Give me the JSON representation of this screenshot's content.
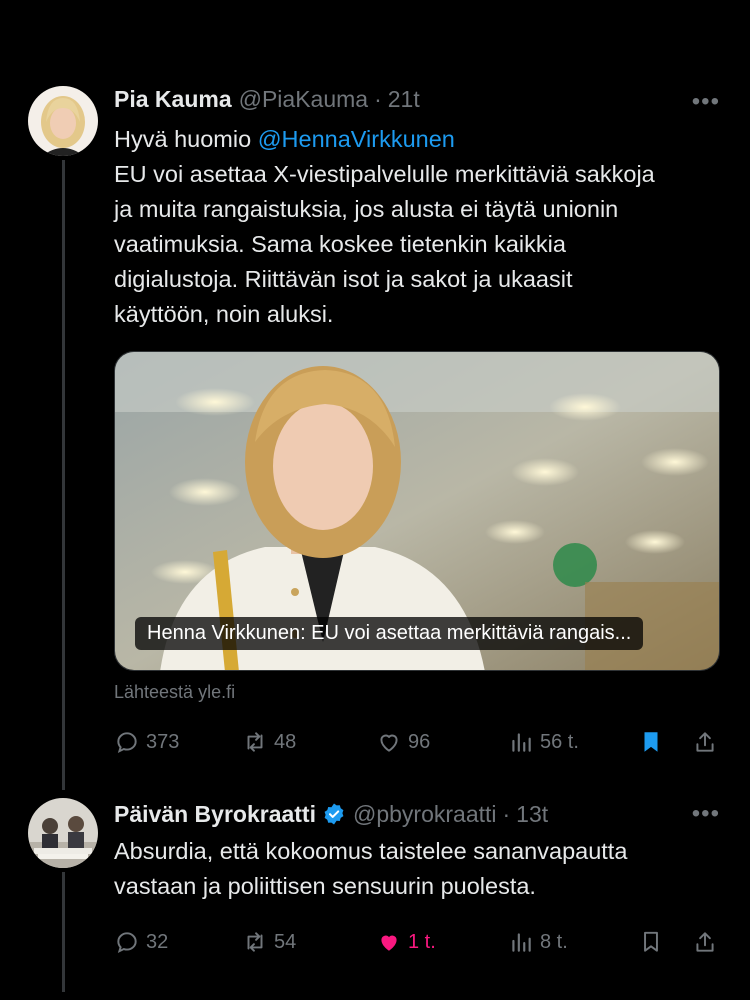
{
  "tweets": [
    {
      "name": "Pia Kauma",
      "handle": "@PiaKauma",
      "time": "21t",
      "verified": false,
      "text_intro": "Hyvä huomio ",
      "mention": "@HennaVirkkunen",
      "text_lines": [
        "EU voi asettaa X-viestipalvelulle merkittäviä sakkoja",
        "ja muita rangaistuksia, jos alusta ei täytä unionin",
        "vaatimuksia. Sama koskee tietenkin kaikkia",
        "digialustoja. Riittävän isot ja sakot ja ukaasit",
        "käyttöön, noin aluksi."
      ],
      "card": {
        "caption": "Henna Virkkunen: EU voi asettaa merkittäviä rangais...",
        "source": "Lähteestä yle.fi"
      },
      "stats": {
        "replies": "373",
        "reposts": "48",
        "likes": "96",
        "views": "56 t."
      },
      "bookmarked": true,
      "liked": false
    },
    {
      "name": "Päivän Byrokraatti",
      "handle": "@pbyrokraatti",
      "time": "13t",
      "verified": true,
      "text_lines": [
        "Absurdia, että kokoomus taistelee sananvapautta",
        "vastaan ja poliittisen sensuurin puolesta."
      ],
      "stats": {
        "replies": "32",
        "reposts": "54",
        "likes": "1 t.",
        "views": "8 t."
      },
      "bookmarked": false,
      "liked": true
    }
  ],
  "ui": {
    "dot": "·",
    "more": "•••"
  },
  "colors": {
    "background": "#000000",
    "text": "#e7e9ea",
    "secondary": "#71767b",
    "link": "#1d9bf0",
    "like": "#f91880",
    "verified": "#1d9bf0"
  },
  "icons": [
    "reply-icon",
    "repost-icon",
    "like-icon",
    "views-icon",
    "bookmark-icon",
    "share-icon",
    "verified-badge-icon",
    "more-icon"
  ]
}
